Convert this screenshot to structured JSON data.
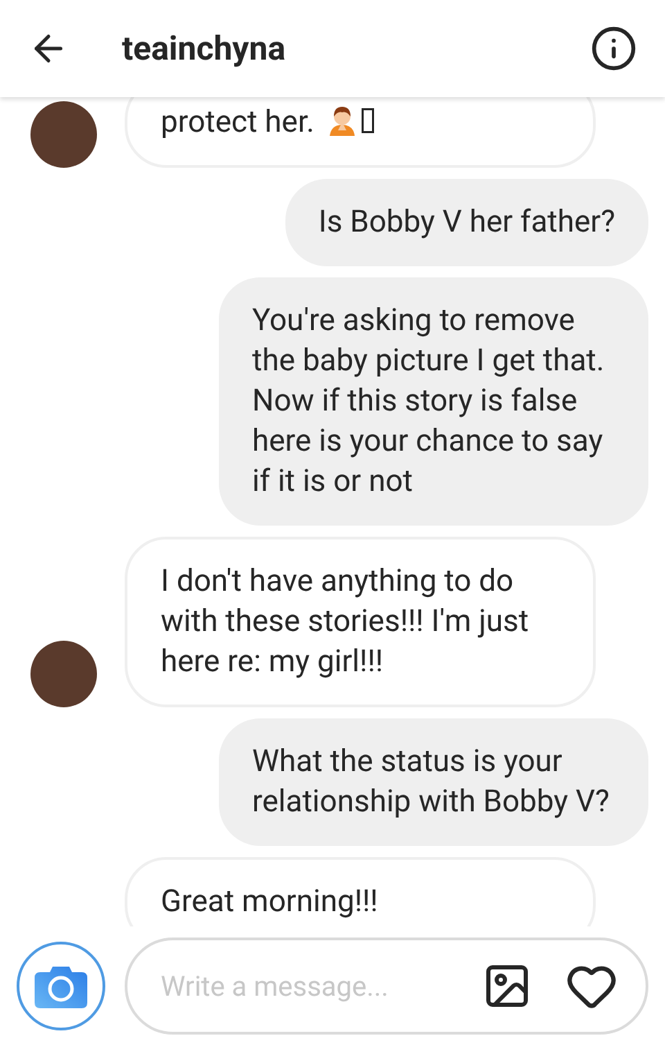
{
  "header": {
    "title": "teainchyna"
  },
  "messages": [
    {
      "kind": "incoming",
      "text": "protect her.",
      "has_emoji": true,
      "show_avatar": true
    },
    {
      "kind": "outgoing",
      "text": "Is Bobby V her father?",
      "has_emoji": false,
      "show_avatar": false
    },
    {
      "kind": "outgoing",
      "text": "You're asking to remove the baby picture I get that. Now if this story is false here is your chance to say if it is or not",
      "has_emoji": false,
      "show_avatar": false
    },
    {
      "kind": "incoming",
      "text": "I don't have anything to do with these stories!!! I'm just here re: my girl!!!",
      "has_emoji": false,
      "show_avatar": true
    },
    {
      "kind": "outgoing",
      "text": "What the status is your relationship with Bobby V?",
      "has_emoji": false,
      "show_avatar": false
    },
    {
      "kind": "incoming",
      "text": "Great morning!!!",
      "has_emoji": false,
      "show_avatar": false
    }
  ],
  "composer": {
    "placeholder": "Write a message..."
  }
}
